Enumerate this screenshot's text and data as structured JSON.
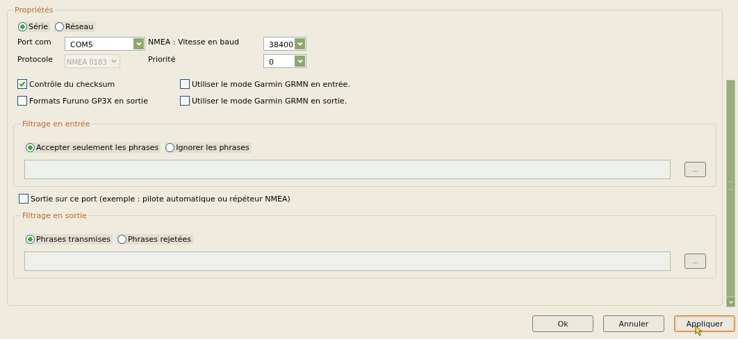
{
  "properties": {
    "title": "Propriétés",
    "connection": [
      {
        "label": "Série",
        "selected": true
      },
      {
        "label": "Réseau",
        "selected": false
      }
    ],
    "port_com": {
      "label": "Port com",
      "value": "COM5",
      "disabled": false
    },
    "baud": {
      "label": "NMEA : Vitesse en baud",
      "value": "38400",
      "disabled": false
    },
    "protocole": {
      "label": "Protocole",
      "value": "NMEA 0183",
      "disabled": true
    },
    "priorite": {
      "label": "Priorité",
      "value": "0",
      "disabled": false
    },
    "options": [
      {
        "label": "Contrôle du checksum",
        "checked": true
      },
      {
        "label": "Utiliser le mode Garmin GRMN en entrée.",
        "checked": false
      },
      {
        "label": "Formats Furuno GP3X en sortie",
        "checked": false
      },
      {
        "label": "Utiliser le mode Garmin GRMN en sortie.",
        "checked": false
      }
    ],
    "input_filter": {
      "title": "Filtrage en entrée",
      "modes": [
        {
          "label": "Accepter seulement les phrases",
          "selected": true
        },
        {
          "label": "Ignorer les phrases",
          "selected": false
        }
      ],
      "browse": "..."
    },
    "output_port": {
      "label": "Sortie sur ce port (exemple : pilote automatique ou répéteur NMEA)",
      "checked": false
    },
    "output_filter": {
      "title": "Filtrage en sortie",
      "modes": [
        {
          "label": "Phrases transmises",
          "selected": true
        },
        {
          "label": "Phrases rejetées",
          "selected": false
        }
      ],
      "browse": "..."
    }
  },
  "buttons": [
    {
      "label": "Ok",
      "focused": false
    },
    {
      "label": "Annuler",
      "focused": false
    },
    {
      "label": "Appliquer",
      "focused": true
    }
  ]
}
